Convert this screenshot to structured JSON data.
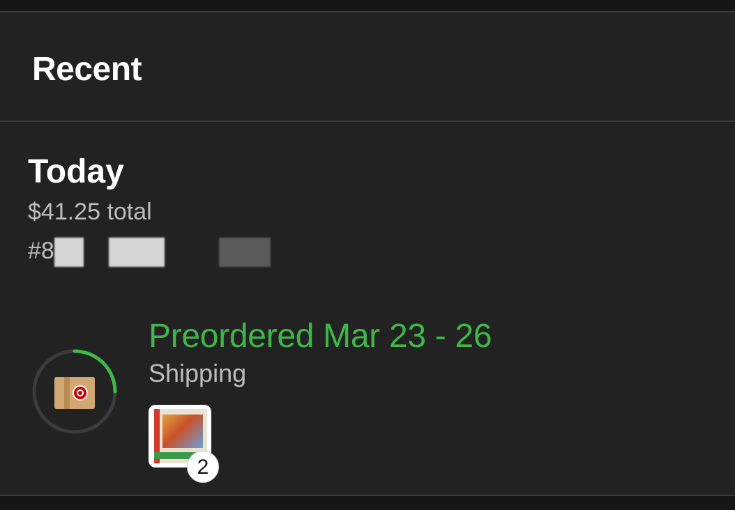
{
  "section": {
    "title": "Recent"
  },
  "order": {
    "date_label": "Today",
    "total": "$41.25 total",
    "number": "#8",
    "status": {
      "title": "Preordered Mar 23 - 26",
      "subtitle": "Shipping",
      "progress_fraction": 0.25,
      "progress_color": "#3fb84a"
    },
    "item_count": "2",
    "icons": {
      "package": "target-package-icon",
      "product": "product-thumbnail"
    }
  },
  "colors": {
    "background": "#222222",
    "accent": "#3fb84a",
    "muted_text": "#bdbdbd"
  }
}
